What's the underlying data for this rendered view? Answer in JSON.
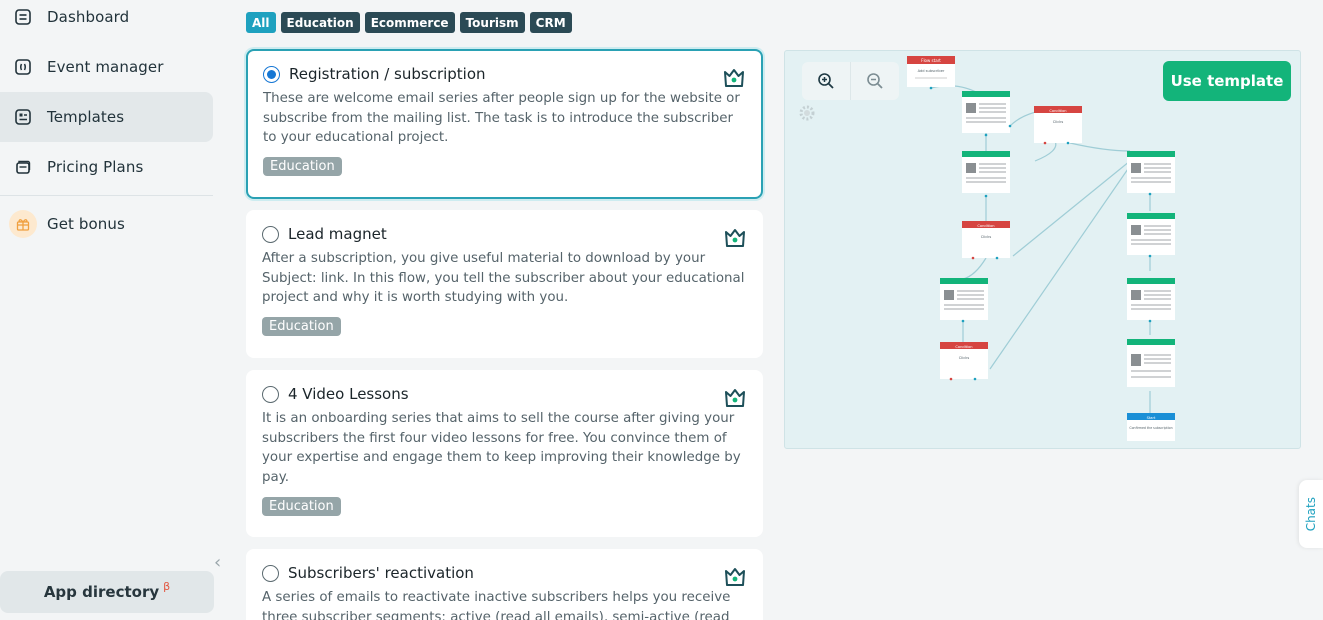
{
  "sidebar": {
    "items": [
      {
        "label": "Dashboard",
        "icon": "dashboard-icon"
      },
      {
        "label": "Event manager",
        "icon": "event-manager-icon"
      },
      {
        "label": "Templates",
        "icon": "templates-icon",
        "active": true
      },
      {
        "label": "Pricing Plans",
        "icon": "pricing-icon"
      },
      {
        "label": "Get bonus",
        "icon": "gift-icon"
      }
    ],
    "app_directory": "App directory",
    "beta_mark": "β"
  },
  "filters": [
    {
      "label": "All",
      "active": true
    },
    {
      "label": "Education"
    },
    {
      "label": "Ecommerce"
    },
    {
      "label": "Tourism"
    },
    {
      "label": "CRM"
    }
  ],
  "templates": [
    {
      "title": "Registration / subscription",
      "description": "These are welcome email series after people sign up for the website or subscribe from the mailing list. The task is to introduce the subscriber to your educational project.",
      "tag": "Education",
      "selected": true
    },
    {
      "title": "Lead magnet",
      "description": "After a subscription, you give useful material to download by your Subject: link. In this flow, you tell the subscriber about your educational project and why it is worth studying with you.",
      "tag": "Education",
      "selected": false
    },
    {
      "title": "4 Video Lessons",
      "description": "It is an onboarding series that aims to sell the course after giving your subscribers the first four video lessons for free. You convince them of your expertise and engage them to keep improving their knowledge by pay.",
      "tag": "Education",
      "selected": false
    },
    {
      "title": "Subscribers' reactivation",
      "description": "A series of emails to reactivate inactive subscribers helps you receive three subscriber segments: active (read all emails), semi-active (read some",
      "tag": "",
      "selected": false
    }
  ],
  "preview": {
    "use_template_label": "Use template",
    "nodes": {
      "flow_start": "Flow start",
      "add_subscriber": "Add subscriber",
      "condition": "Condition",
      "clicks": "Clicks",
      "start": "Start",
      "confirmed": "Confirmed the subscription"
    }
  },
  "chats_label": "Chats",
  "colors": {
    "accent": "#1ea1bf",
    "primary_green": "#13b47a",
    "filter_dark": "#2b4a55",
    "tag_gray": "#95a5a8",
    "condition_red": "#d64541",
    "start_blue": "#1a8fd6"
  }
}
